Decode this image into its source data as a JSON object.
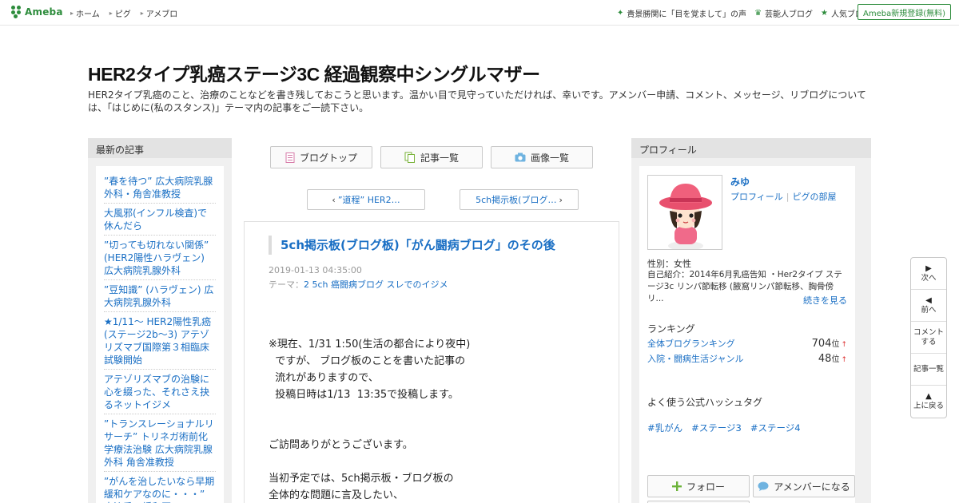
{
  "topbar": {
    "logo_text": "Ameba",
    "nav": [
      "ホーム",
      "ピグ",
      "アメブロ"
    ],
    "right_links": [
      {
        "label": "貴景勝関に「目を覚まして」の声",
        "icon": "sparkle-icon"
      },
      {
        "label": "芸能人ブログ",
        "icon": "crown-icon"
      },
      {
        "label": "人気ブログ",
        "icon": "star-icon"
      }
    ],
    "signup_label": "Ameba新規登録(無料)"
  },
  "header": {
    "title": "HER2タイプ乳癌ステージ3C 経過観察中シングルマザー",
    "description": "HER2タイプ乳癌のこと、治療のことなどを書き残しておこうと思います。温かい目で見守っていただければ、幸いです。アメンバー申請、コメント、メッセージ、リブログについては、「はじめに(私のスタンス)」テーマ内の記事をご一読下さい。"
  },
  "left_sidebar": {
    "heading": "最新の記事",
    "items": [
      "”春を待つ” 広大病院乳腺外科・角舎准教授",
      "大風邪(インフル検査)で休んだら",
      "”切っても切れない関係” (HER2陽性ハラヴェン) 広大病院乳腺外科",
      "”豆知識” (ハラヴェン) 広大病院乳腺外科",
      "★1/11～ HER2陽性乳癌(ステージ2b～3) アテゾリズマブ国際第３相臨床試験開始",
      "アテゾリズマブの治験に心を綴った、それさえ抉るネットイジメ",
      "”トランスレーショナルリサーチ” トリネガ術前化学療法治験 広大病院乳腺外科 角舎准教授",
      "”がんを治したいなら早期緩和ケアなのに・・・” 大津秀一緩和医"
    ]
  },
  "main": {
    "tabs": [
      {
        "label": "ブログトップ",
        "icon": "document-icon"
      },
      {
        "label": "記事一覧",
        "icon": "copy-icon"
      },
      {
        "label": "画像一覧",
        "icon": "camera-icon"
      }
    ],
    "prev_label": "”道程” HER2…",
    "next_label": "5ch掲示板(ブログ…",
    "article": {
      "title": "5ch掲示板(ブログ板)「がん闘病ブログ」のその後",
      "date": "2019-01-13 04:35:00",
      "theme_prefix": "テーマ：",
      "theme": "2 5ch 癌闘病ブログ スレでのイジメ",
      "body": "※現在、1/31 1:50(生活の都合により夜中)\n  ですが、 ブログ板のことを書いた記事の\n  流れがありますので、\n  投稿日時は1/13  13:35で投稿します。\n\n\nご訪問ありがとうございます。\n\n当初予定では、5ch掲示板・ブログ板の\n全体的な問題に言及したい、"
    }
  },
  "right_sidebar": {
    "heading": "プロフィール",
    "name": "みゆ",
    "links": [
      "プロフィール",
      "ピグの部屋"
    ],
    "gender": "性別：女性",
    "intro": "自己紹介：2014年6月乳癌告知 ・Her2タイプ ステージ3c リンパ節転移 (腋窩リンパ節転移、胸骨傍リ...",
    "more_label": "続きを見る",
    "ranking_heading": "ランキング",
    "rankings": [
      {
        "label": "全体ブログランキング",
        "value": "704",
        "unit": "位",
        "trend": "↑"
      },
      {
        "label": "入院・闘病生活ジャンル",
        "value": "48",
        "unit": "位",
        "trend": "↑"
      }
    ],
    "hashtag_heading": "よく使う公式ハッシュタグ",
    "hashtags": [
      "#乳がん",
      "#ステージ3",
      "#ステージ4"
    ],
    "follow_label": "フォロー",
    "amember_label": "アメンバーになる"
  },
  "floatnav": [
    {
      "label": "次へ",
      "icon": "triangle-right-icon"
    },
    {
      "label": "前へ",
      "icon": "triangle-left-icon"
    },
    {
      "label": "コメントする",
      "icon": ""
    },
    {
      "label": "記事一覧",
      "icon": ""
    },
    {
      "label": "上に戻る",
      "icon": "triangle-up-icon"
    }
  ],
  "colors": {
    "brand": "#2d8c3c",
    "link": "#1a6fc4",
    "panel": "#f0f0f0",
    "panel_head": "#e3e3e3"
  }
}
